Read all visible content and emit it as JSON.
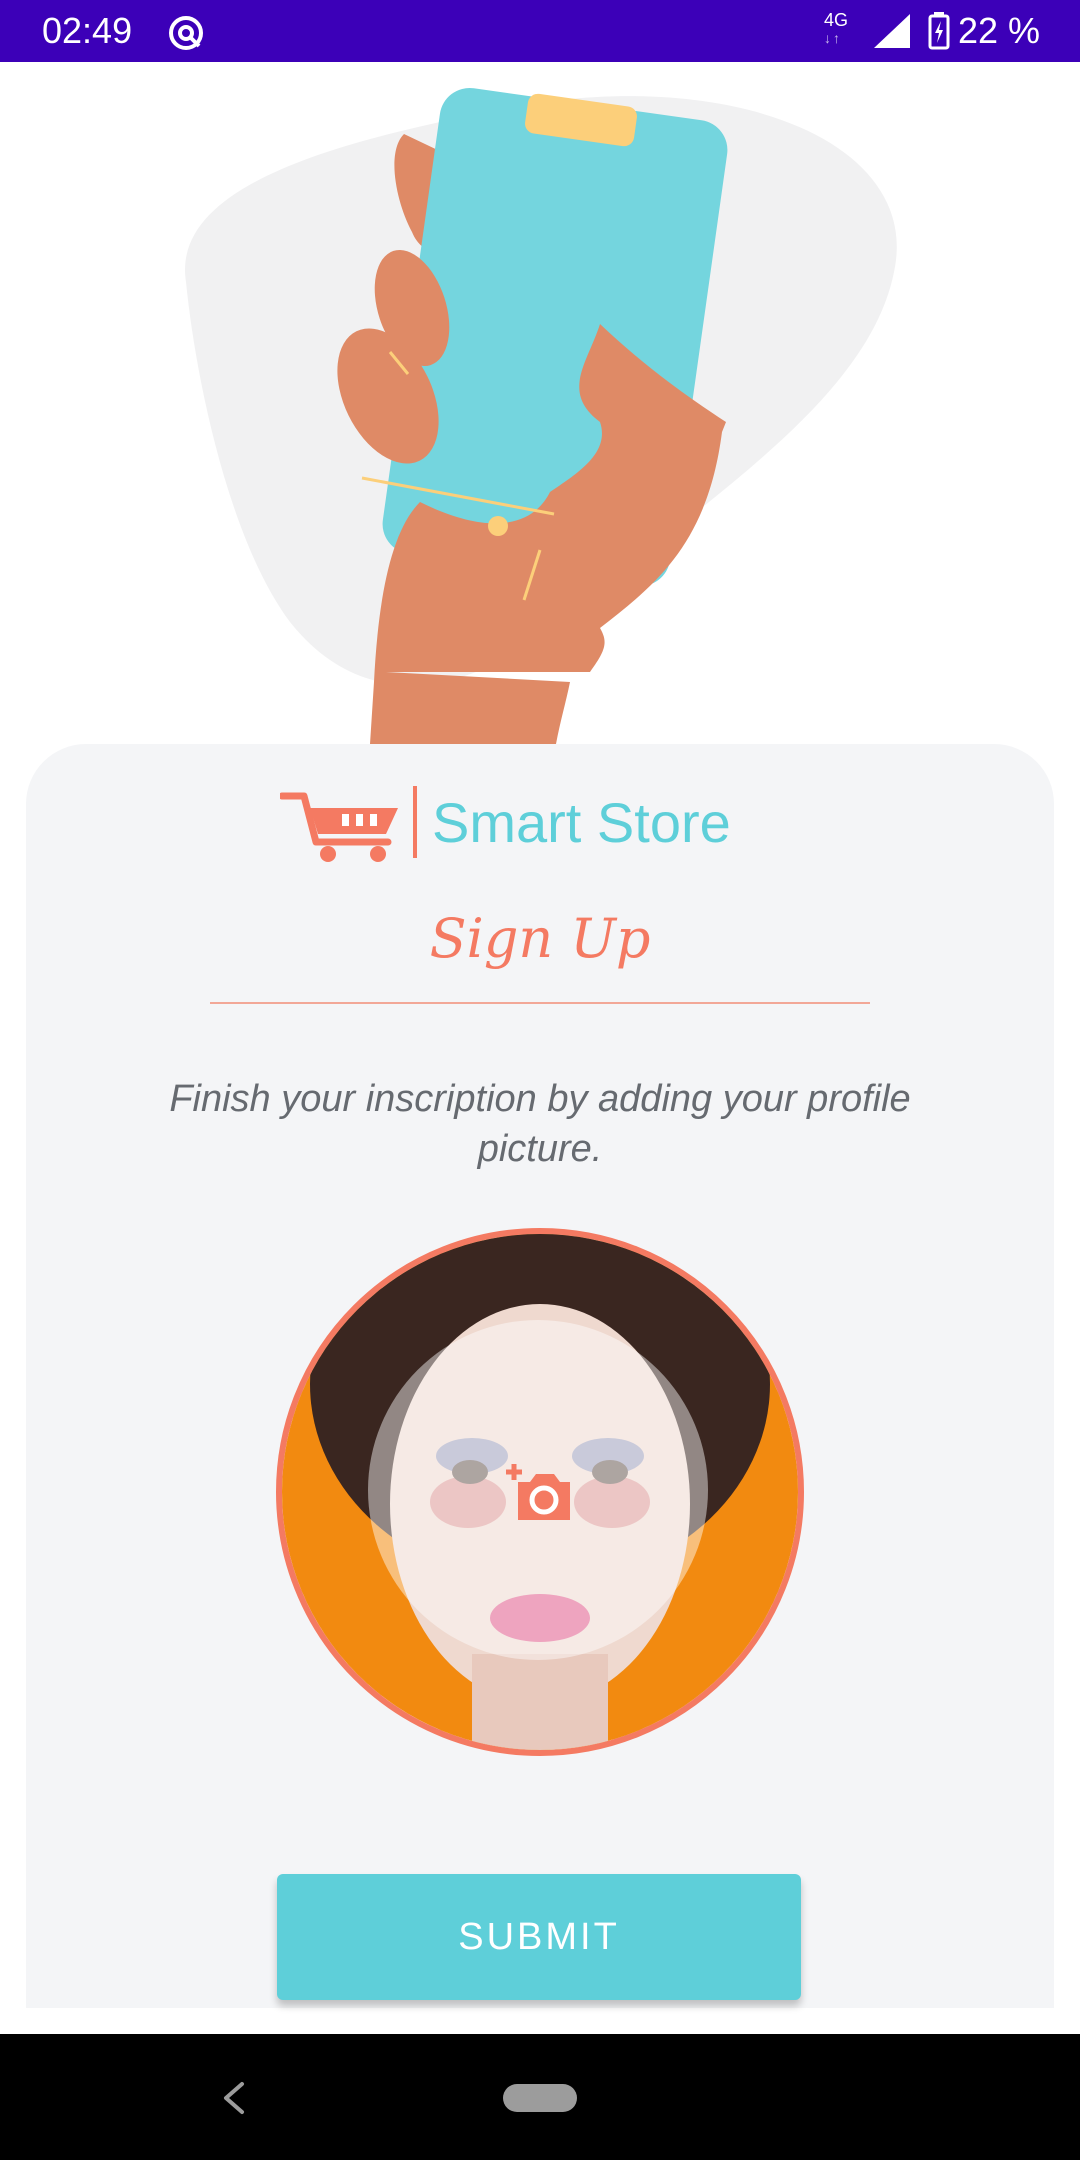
{
  "status_bar": {
    "time": "02:49",
    "network_type": "4G",
    "battery_text": "22 %",
    "icons": [
      "sync-icon",
      "signal-icon",
      "battery-icon"
    ]
  },
  "brand": {
    "name": "Smart Store",
    "logo_icon": "shopping-cart-icon"
  },
  "signup": {
    "title": "Sign Up",
    "instruction": "Finish your inscription by adding your profile picture.",
    "add_photo_icon": "add-photo-icon",
    "submit_label": "SUBMIT"
  },
  "colors": {
    "status_bar": "#3c00b8",
    "accent_teal": "#5ecfd9",
    "accent_coral": "#f47a62",
    "card_background": "#f4f5f7"
  },
  "nav_bar": {
    "icons": [
      "back-icon",
      "home-pill-icon"
    ]
  }
}
